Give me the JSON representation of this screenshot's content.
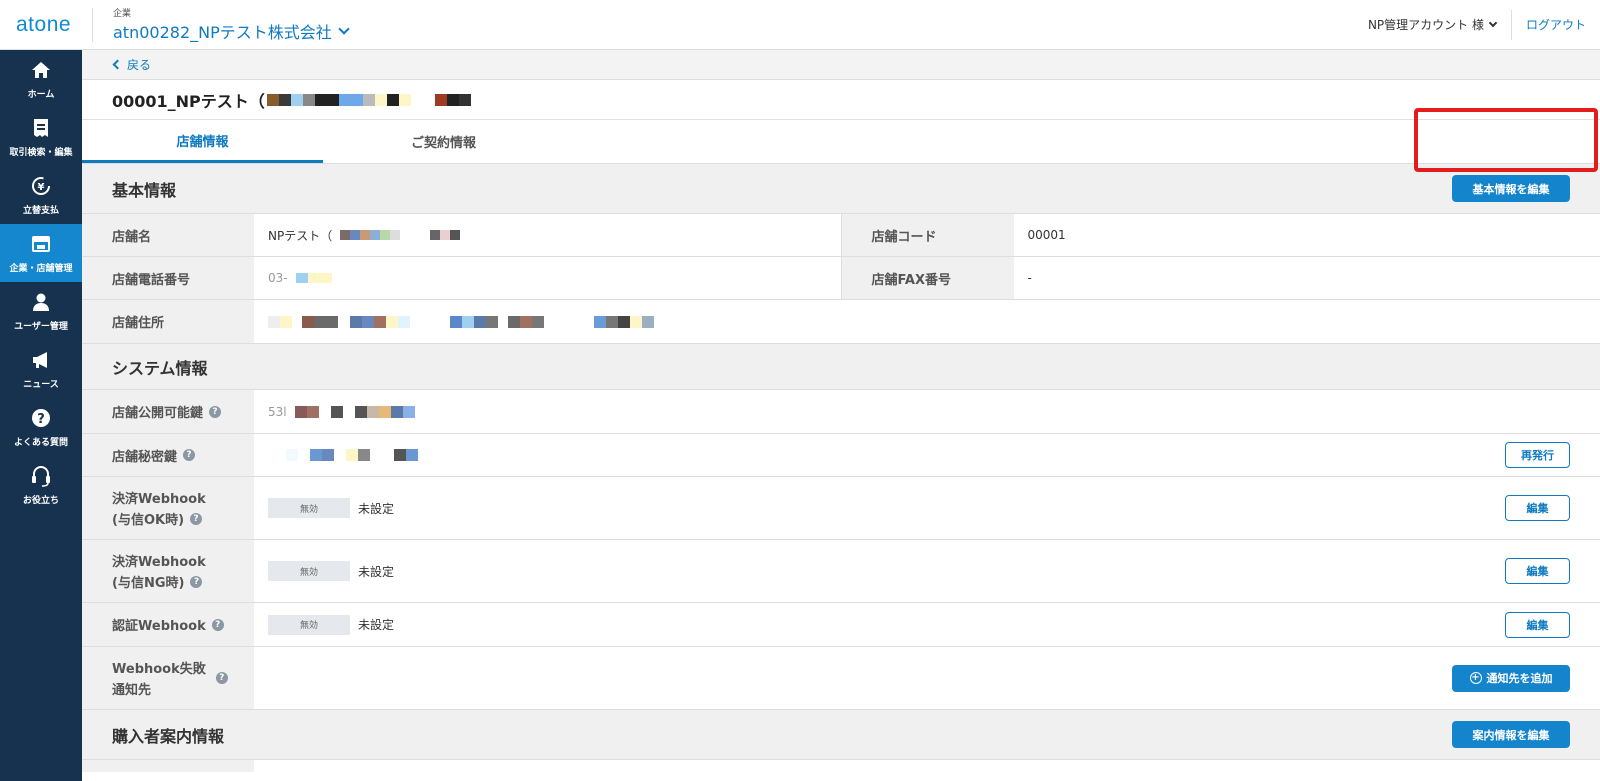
{
  "header": {
    "logo": "atone",
    "company_label": "企業",
    "company_name": "atn00282_NPテスト株式会社",
    "account": "NP管理アカウント 様",
    "logout": "ログアウト"
  },
  "sidebar": {
    "items": [
      {
        "label": "ホーム",
        "icon": "home-icon"
      },
      {
        "label": "取引検索・編集",
        "icon": "receipt-icon"
      },
      {
        "label": "立替支払",
        "icon": "yen-cycle-icon"
      },
      {
        "label": "企業・店舗管理",
        "icon": "store-icon",
        "active": true
      },
      {
        "label": "ユーザー管理",
        "icon": "user-icon"
      },
      {
        "label": "ニュース",
        "icon": "megaphone-icon"
      },
      {
        "label": "よくある質問",
        "icon": "question-icon"
      },
      {
        "label": "お役立ち",
        "icon": "headset-icon"
      }
    ]
  },
  "back_label": "戻る",
  "store_title_prefix": "00001_NPテスト（",
  "tabs": [
    {
      "label": "店舗情報",
      "active": true
    },
    {
      "label": "ご契約情報",
      "active": false
    }
  ],
  "basic": {
    "title": "基本情報",
    "edit_button": "基本情報を編集",
    "store_name_label": "店舗名",
    "store_name_value": "NPテスト（",
    "store_code_label": "店舗コード",
    "store_code_value": "00001",
    "phone_label": "店舗電話番号",
    "phone_value": "03-",
    "fax_label": "店舗FAX番号",
    "fax_value": "-",
    "address_label": "店舗住所"
  },
  "system": {
    "title": "システム情報",
    "public_key_label": "店舗公開可能鍵",
    "public_key_value": "53l",
    "secret_key_label": "店舗秘密鍵",
    "reissue_button": "再発行",
    "webhook_ok_label_1": "決済Webhook",
    "webhook_ok_label_2": "(与信OK時)",
    "webhook_ng_label_1": "決済Webhook",
    "webhook_ng_label_2": "(与信NG時)",
    "auth_webhook_label": "認証Webhook",
    "fail_label_1": "Webhook失敗",
    "fail_label_2": "通知先",
    "disabled_badge": "無効",
    "not_set": "未設定",
    "edit_button": "編集",
    "add_notify_button": "通知先を追加"
  },
  "buyer": {
    "title": "購入者案内情報",
    "edit_button": "案内情報を編集"
  },
  "colors": {
    "accent": "#1485cc",
    "sidebar_bg": "#16324f",
    "sidebar_active": "#1487cf",
    "highlight": "#e31c1c"
  }
}
